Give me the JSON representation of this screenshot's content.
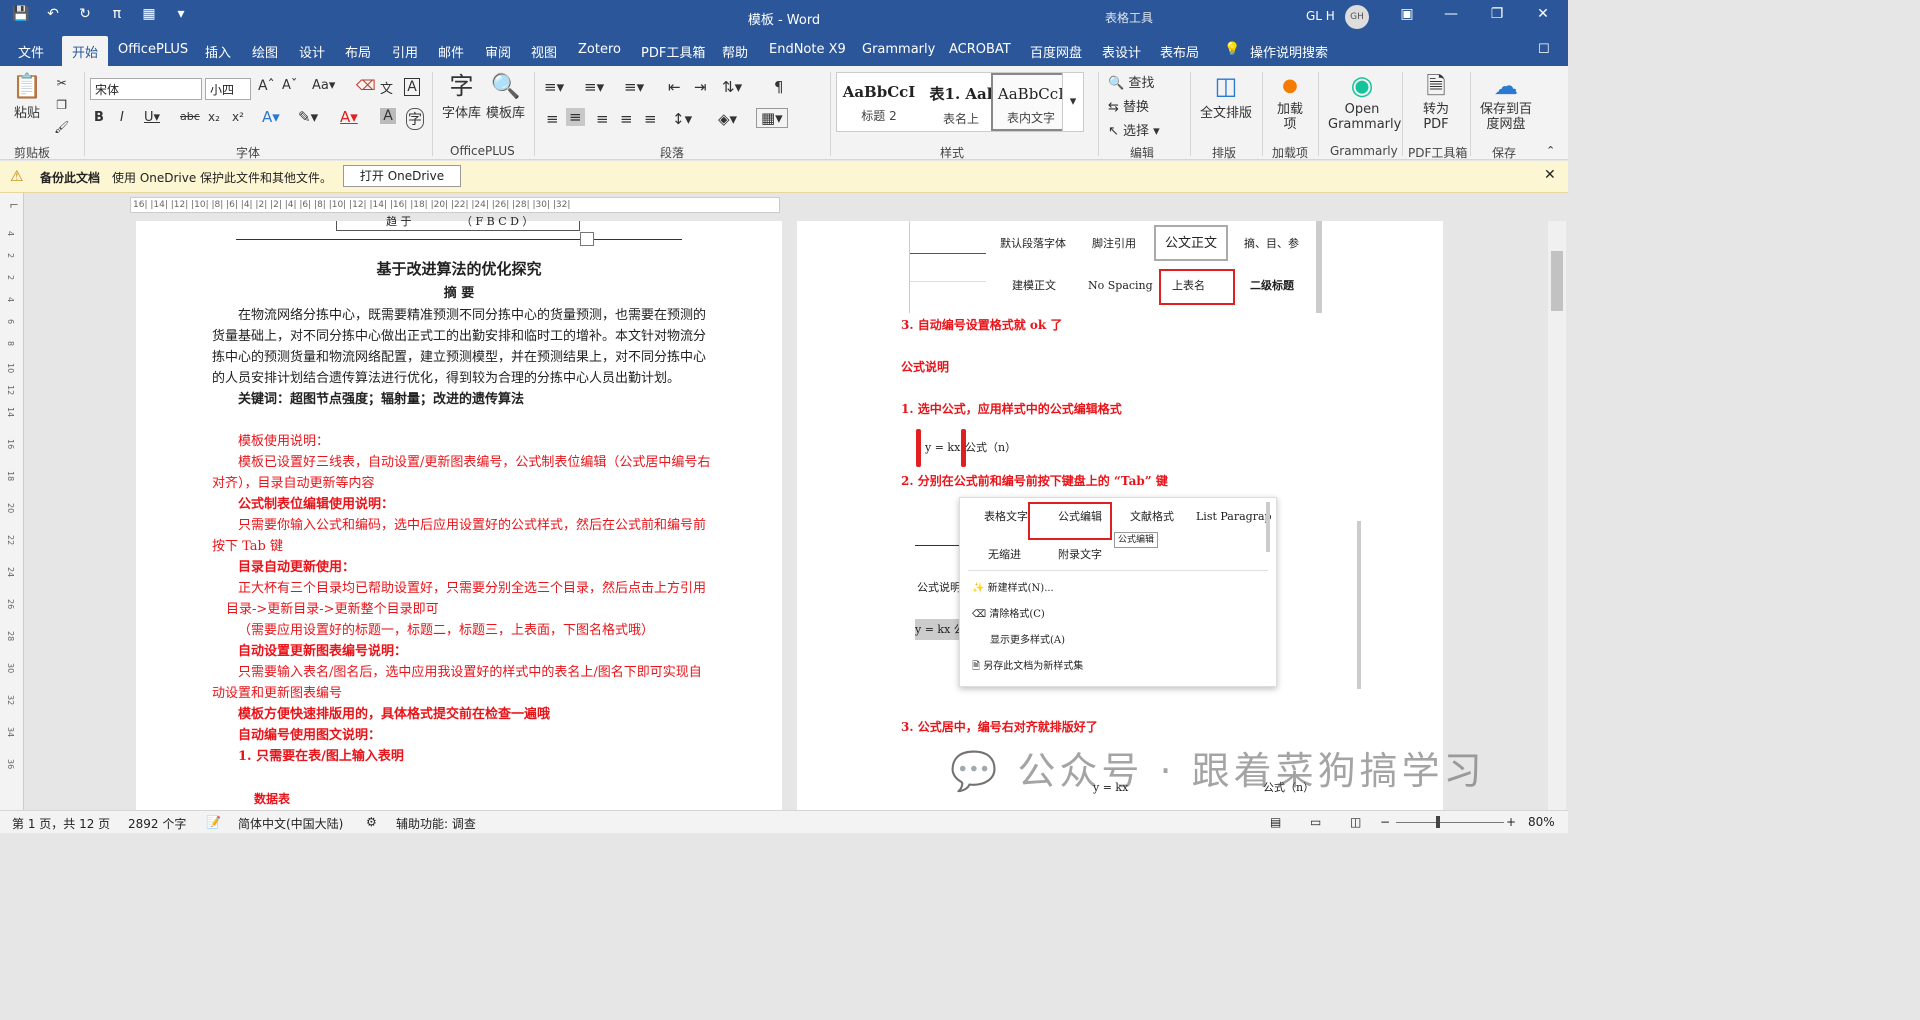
{
  "window": {
    "title": "模板  -  Word",
    "context_tools": "表格工具",
    "user_name": "GL H",
    "user_initials": "GH",
    "quick_access": [
      "save-icon",
      "undo-icon",
      "redo-icon",
      "pi-icon",
      "table-icon",
      "customize-icon"
    ]
  },
  "tabs": [
    "文件",
    "开始",
    "OfficePLUS",
    "插入",
    "绘图",
    "设计",
    "布局",
    "引用",
    "邮件",
    "审阅",
    "视图",
    "Zotero",
    "PDF工具箱",
    "帮助",
    "EndNote X9",
    "Grammarly",
    "ACROBAT",
    "百度网盘",
    "表设计",
    "表布局"
  ],
  "active_tab": "开始",
  "tell_me": "操作说明搜索",
  "ribbon": {
    "clipboard": {
      "label": "剪贴板",
      "paste": "粘贴"
    },
    "font": {
      "label": "字体",
      "family": "宋体",
      "size": "小四"
    },
    "officeplus": {
      "label": "OfficePLUS",
      "fontlib": "字体库",
      "templates": "模板库"
    },
    "paragraph": {
      "label": "段落"
    },
    "styles": {
      "label": "样式",
      "items": [
        {
          "sample": "AaBbCcI",
          "name": "标题 2"
        },
        {
          "sample": "表1. Aal",
          "name": "表名上"
        },
        {
          "sample": "AaBbCcI",
          "name": "表内文字"
        }
      ]
    },
    "editing": {
      "label": "编辑",
      "find": "查找",
      "replace": "替换",
      "select": "选择"
    },
    "layout": {
      "label": "排版",
      "full": "全文排版"
    },
    "addins": {
      "label": "加载项",
      "load": "加载项"
    },
    "grammarly": {
      "label": "Grammarly",
      "open": "Open Grammarly"
    },
    "pdf": {
      "label": "PDF工具箱",
      "convert": "转为PDF"
    },
    "save": {
      "label": "保存",
      "save_to": "保存到百度网盘"
    }
  },
  "infobar": {
    "title": "备份此文档",
    "message": "使用 OneDrive 保护此文件和其他文件。",
    "button": "打开 OneDrive"
  },
  "ruler": {
    "text": "16| |14| |12| |10| |8| |6| |4| |2| |2| |4| |6| |8| |10| |12| |14| |16| |18| |20| |22| |24| |26| |28| |30| |32|"
  },
  "vruler": [
    "4",
    "2",
    "2",
    "4",
    "6",
    "8",
    "10",
    "12",
    "14",
    "16",
    "18",
    "20",
    "22",
    "24",
    "26",
    "28",
    "30",
    "32",
    "34",
    "36"
  ],
  "left_page": {
    "table_fragment": [
      "趋 于",
      "（ F B C D ）"
    ],
    "title": "基于改进算法的优化探究",
    "abstract_heading": "摘  要",
    "abstract_lines": [
      "在物流网络分拣中心，既需要精准预测不同分拣中心的货量预测，也需要在预测的",
      "货量基础上，对不同分拣中心做出正式工的出勤安排和临时工的增补。本文针对物流分",
      "拣中心的预测货量和物流网络配置，建立预测模型，并在预测结果上，对不同分拣中心",
      "的人员安排计划结合遗传算法进行优化，得到较为合理的分拣中心人员出勤计划。"
    ],
    "keywords": "关键词：超图节点强度；辐射量；改进的遗传算法",
    "instructions": [
      {
        "text": "模板使用说明：",
        "bold": false
      },
      {
        "text": "模板已设置好三线表，自动设置/更新图表编号，公式制表位编辑（公式居中编号右",
        "bold": false
      },
      {
        "text": "对齐），目录自动更新等内容",
        "bold": false
      },
      {
        "text": "公式制表位编辑使用说明：",
        "bold": true
      },
      {
        "text": "只需要你输入公式和编码，选中后应用设置好的公式样式，然后在公式前和编号前",
        "bold": false
      },
      {
        "text": "按下 Tab 键",
        "bold": false
      },
      {
        "text": "目录自动更新使用：",
        "bold": true
      },
      {
        "text": "正大杯有三个目录均已帮助设置好，只需要分别全选三个目录，然后点击上方引用",
        "bold": false
      },
      {
        "text": "目录->更新目录->更新整个目录即可",
        "bold": false
      },
      {
        "text": "（需要应用设置好的标题一，标题二，标题三，上表面，下图名格式哦）",
        "bold": false
      },
      {
        "text": "自动设置更新图表编号说明：",
        "bold": true
      },
      {
        "text": "只需要输入表名/图名后，选中应用我设置好的样式中的表名上/图名下即可实现自",
        "bold": false
      },
      {
        "text": "动设置和更新图表编号",
        "bold": false
      },
      {
        "text": "模板方便快速排版用的，具体格式提交前在检查一遍哦",
        "bold": true
      },
      {
        "text": "自动编号使用图文说明：",
        "bold": true
      },
      {
        "text": "1. 只需要在表/图上输入表明",
        "bold": true
      }
    ],
    "data_table_label": "数据表"
  },
  "right_page": {
    "style_gallery_1": [
      "默认段落字体",
      "脚注引用",
      "公文正文",
      "摘、目、参",
      "建模正文",
      "No Spacing",
      "上表名",
      "二级标题"
    ],
    "step3": "3. 自动编号设置格式就 ok 了",
    "formula_heading": "公式说明",
    "formula_step1": "1. 选中公式，应用样式中的公式编辑格式",
    "formula_sample": "y = kx",
    "formula_number": "公式（n）",
    "formula_step2": "2. 分别在公式前和编号前按下键盘上的 “Tab” 键",
    "style_gallery_2": [
      "表格文字",
      "公式编辑",
      "文献格式",
      "List Paragraph",
      "无缩进",
      "附录文字"
    ],
    "tooltip": "公式编辑",
    "context_menu": [
      "新建样式(N)...",
      "清除格式(C)",
      "显示更多样式(A)",
      "另存此文档为新样式集"
    ],
    "background_text": [
      "公式说明",
      "y = kx 公"
    ],
    "formula_step3": "3. 公式居中，编号右对齐就排版好了",
    "bottom_formula": "y = kx",
    "bottom_number": "公式（n）"
  },
  "watermark": "公众号 · 跟着菜狗搞学习",
  "statusbar": {
    "page": "第 1 页，共 12 页",
    "words": "2892 个字",
    "language": "简体中文(中国大陆)",
    "accessibility": "辅助功能: 调查",
    "zoom": "80%"
  }
}
